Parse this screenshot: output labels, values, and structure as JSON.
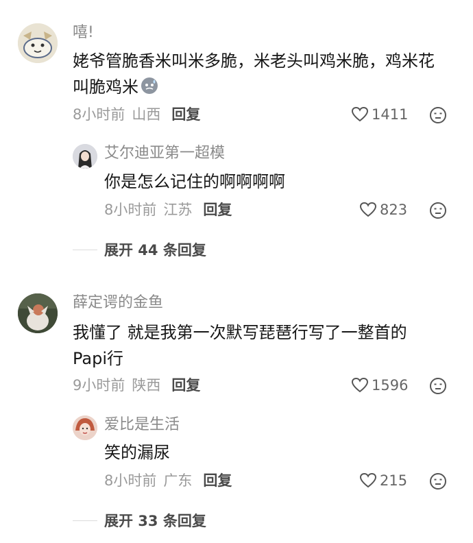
{
  "comments": [
    {
      "username": "嘻!",
      "text": "姥爷管脆香米叫米多脆，米老头叫鸡米脆，鸡米花叫脆鸡米",
      "time": "8小时前",
      "location": "山西",
      "reply_label": "回复",
      "likes": "1411",
      "emoji": "sweat-face-icon",
      "reply": {
        "username": "艾尔迪亚第一超模",
        "text": "你是怎么记住的啊啊啊啊",
        "time": "8小时前",
        "location": "江苏",
        "reply_label": "回复",
        "likes": "823"
      },
      "expand_label": "展开 44 条回复"
    },
    {
      "username": "薛定谔的金鱼",
      "text": "我懂了 就是我第一次默写琵琶行写了一整首的Papi行",
      "time": "9小时前",
      "location": "陕西",
      "reply_label": "回复",
      "likes": "1596",
      "reply": {
        "username": "爱比是生活",
        "text": "笑的漏尿",
        "time": "8小时前",
        "location": "广东",
        "reply_label": "回复",
        "likes": "215"
      },
      "expand_label": "展开 33 条回复"
    }
  ],
  "colors": {
    "text": "#161616",
    "muted": "#9a9a9a",
    "reply": "#4a4a4a"
  }
}
